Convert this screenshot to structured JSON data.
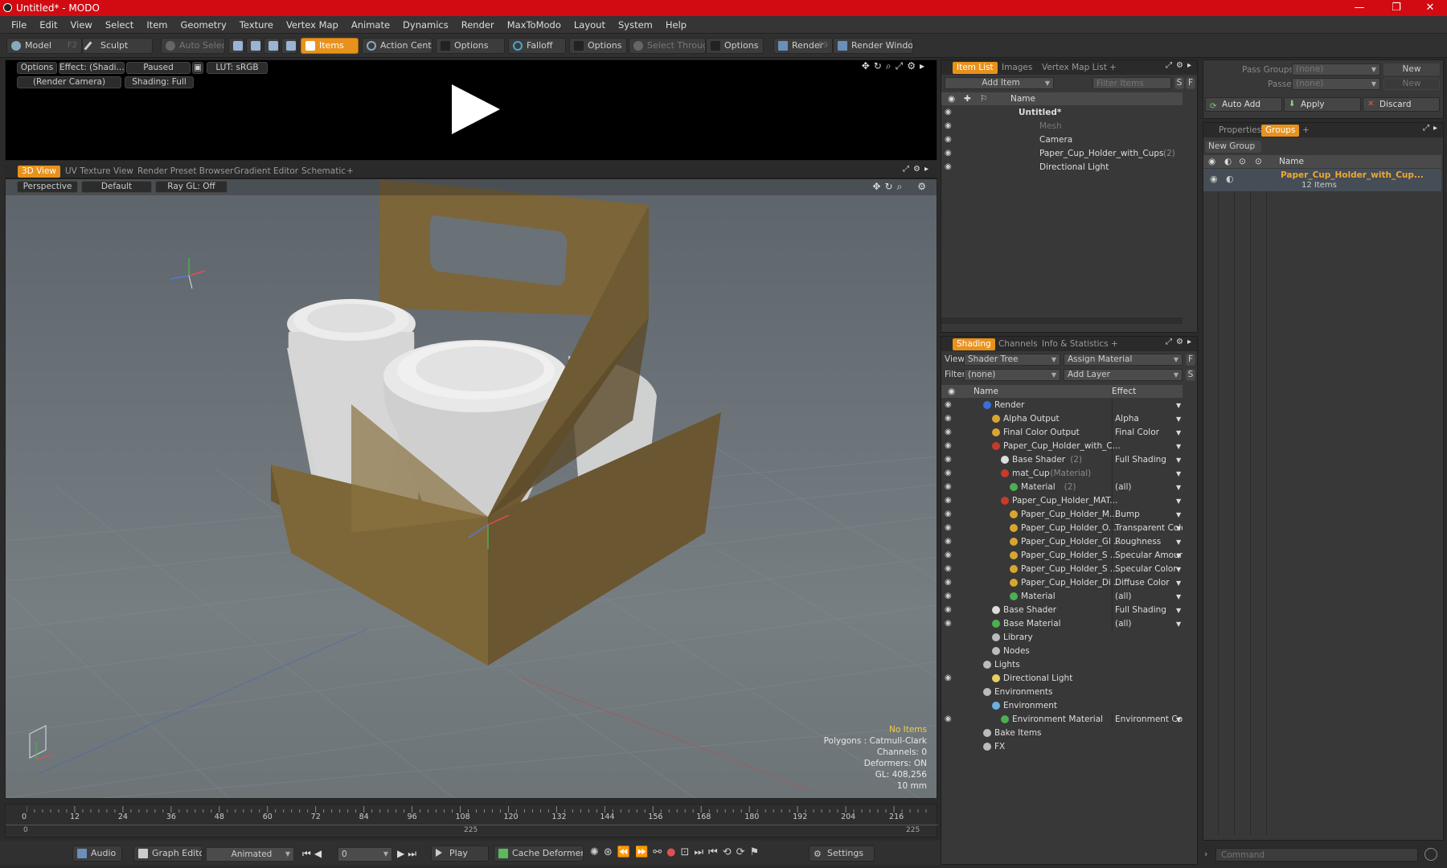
{
  "window": {
    "title": "Untitled* - MODO",
    "min": "—",
    "max": "❐",
    "close": "✕"
  },
  "menu": [
    "File",
    "Edit",
    "View",
    "Select",
    "Item",
    "Geometry",
    "Texture",
    "Vertex Map",
    "Animate",
    "Dynamics",
    "Render",
    "MaxToModo",
    "Layout",
    "System",
    "Help"
  ],
  "toolbar": {
    "model": "Model",
    "model_key": "F2",
    "sculpt": "Sculpt",
    "auto_select": "Auto Select",
    "items": "Items",
    "action_center": "Action Center",
    "options1": "Options",
    "falloff": "Falloff",
    "options2": "Options",
    "select_through": "Select Through",
    "options3": "Options",
    "render": "Render",
    "render_key": "F9",
    "render_window": "Render Window"
  },
  "preview": {
    "options": "Options",
    "effect": "Effect: (Shadi...",
    "paused": "Paused",
    "lut": "LUT: sRGB",
    "camera": "(Render Camera)",
    "shading": "Shading: Full"
  },
  "viewtabs": [
    "3D View",
    "UV Texture View",
    "Render Preset Browser",
    "Gradient Editor",
    "Schematic",
    "+"
  ],
  "viewport": {
    "perspective": "Perspective",
    "default": "Default",
    "raygl": "Ray GL: Off"
  },
  "hud": {
    "no_items": "No Items",
    "polygons": "Polygons : Catmull-Clark",
    "channels": "Channels: 0",
    "deformers": "Deformers: ON",
    "gl": "GL: 408,256",
    "unit": "10 mm"
  },
  "timeline": {
    "ticks": [
      "0",
      "12",
      "24",
      "36",
      "48",
      "60",
      "72",
      "84",
      "96",
      "108",
      "120",
      "132",
      "144",
      "156",
      "168",
      "180",
      "192",
      "204",
      "216"
    ],
    "start": "0",
    "mid": "225",
    "end": "225"
  },
  "bottombar": {
    "audio": "Audio",
    "graph_editor": "Graph Editor",
    "animated": "Animated",
    "frame": "0",
    "play": "Play",
    "cache": "Cache Deformers",
    "settings": "Settings"
  },
  "itemlist": {
    "tabs": [
      "Item List",
      "Images",
      "Vertex Map List",
      "+"
    ],
    "add_item": "Add Item",
    "filter": "Filter Items",
    "col_name": "Name",
    "rows": [
      {
        "label": "Untitled*",
        "bold": true
      },
      {
        "label": "Mesh",
        "dim": true
      },
      {
        "label": "Camera"
      },
      {
        "label": "Paper_Cup_Holder_with_Cups",
        "count": "(2)"
      },
      {
        "label": "Directional Light"
      }
    ]
  },
  "shading": {
    "tabs": [
      "Shading",
      "Channels",
      "Info & Statistics",
      "+"
    ],
    "view_label": "View",
    "view_value": "Shader Tree",
    "assign": "Assign Material",
    "filter_label": "Filter",
    "filter_value": "(none)",
    "add_layer": "Add Layer",
    "col_name": "Name",
    "col_effect": "Effect",
    "rows": [
      {
        "label": "Render",
        "effect": "",
        "indent": 0
      },
      {
        "label": "Alpha Output",
        "effect": "Alpha",
        "indent": 1
      },
      {
        "label": "Final Color Output",
        "effect": "Final Color",
        "indent": 1
      },
      {
        "label": "Paper_Cup_Holder_with_C...",
        "effect": "",
        "indent": 1
      },
      {
        "label": "Base Shader",
        "note": "(2)",
        "effect": "Full Shading",
        "indent": 2
      },
      {
        "label": "mat_Cup",
        "note": "(Material)",
        "effect": "",
        "indent": 2
      },
      {
        "label": "Material",
        "note": "(2)",
        "effect": "(all)",
        "indent": 3
      },
      {
        "label": "Paper_Cup_Holder_MAT...",
        "effect": "",
        "indent": 2
      },
      {
        "label": "Paper_Cup_Holder_M...",
        "effect": "Bump",
        "indent": 3
      },
      {
        "label": "Paper_Cup_Holder_O...",
        "effect": "Transparent Color",
        "indent": 3
      },
      {
        "label": "Paper_Cup_Holder_Gl...",
        "effect": "Roughness",
        "indent": 3
      },
      {
        "label": "Paper_Cup_Holder_S ...",
        "effect": "Specular Amount",
        "indent": 3
      },
      {
        "label": "Paper_Cup_Holder_S ...",
        "effect": "Specular Color",
        "indent": 3
      },
      {
        "label": "Paper_Cup_Holder_Di...",
        "effect": "Diffuse Color",
        "indent": 3
      },
      {
        "label": "Material",
        "effect": "(all)",
        "indent": 3
      },
      {
        "label": "Base Shader",
        "effect": "Full Shading",
        "indent": 1
      },
      {
        "label": "Base Material",
        "effect": "(all)",
        "indent": 1
      },
      {
        "label": "Library",
        "effect": "",
        "indent": 1
      },
      {
        "label": "Nodes",
        "effect": "",
        "indent": 1
      },
      {
        "label": "Lights",
        "effect": "",
        "indent": 0
      },
      {
        "label": "Directional Light",
        "effect": "",
        "indent": 1
      },
      {
        "label": "Environments",
        "effect": "",
        "indent": 0
      },
      {
        "label": "Environment",
        "effect": "",
        "indent": 1
      },
      {
        "label": "Environment Material",
        "effect": "Environment Color",
        "indent": 2
      },
      {
        "label": "Bake Items",
        "effect": "",
        "indent": 0
      },
      {
        "label": "FX",
        "effect": "",
        "indent": 0
      }
    ]
  },
  "passes": {
    "pass_groups": "Pass Groups",
    "passes": "Passes",
    "none1": "(none)",
    "none2": "(none)",
    "new1": "New",
    "new2": "New",
    "auto_add": "Auto Add",
    "apply": "Apply",
    "discard": "Discard"
  },
  "groups": {
    "tabs": [
      "Properties",
      "Groups",
      "+"
    ],
    "new_group": "New Group",
    "col_name": "Name",
    "item": "Paper_Cup_Holder_with_Cup...",
    "count": "12 Items"
  },
  "command": {
    "placeholder": "Command"
  }
}
